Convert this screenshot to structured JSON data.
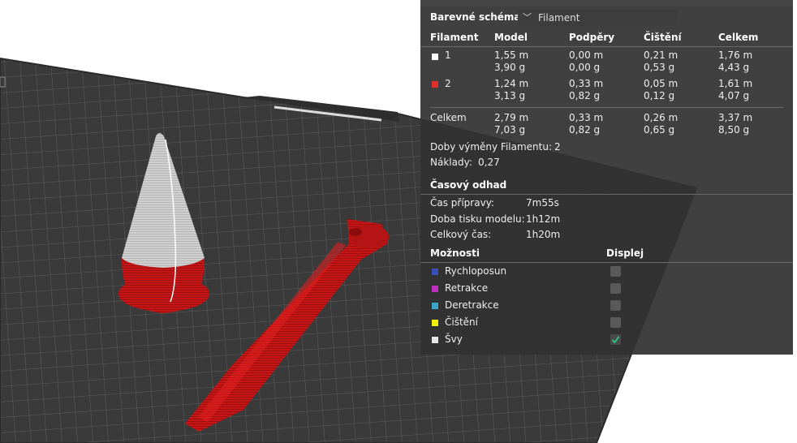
{
  "panel": {
    "color_scheme_label": "Barevné schéma",
    "color_scheme_value": "Filament",
    "columns": [
      "Filament",
      "Model",
      "Podpěry",
      "Čištění",
      "Celkem"
    ],
    "rows": [
      {
        "name": "1",
        "color": "#ffffff",
        "model": [
          "1,55 m",
          "3,90 g"
        ],
        "supports": [
          "0,00 m",
          "0,00 g"
        ],
        "purge": [
          "0,21 m",
          "0,53 g"
        ],
        "total": [
          "1,76 m",
          "4,43 g"
        ]
      },
      {
        "name": "2",
        "color": "#e0302a",
        "model": [
          "1,24 m",
          "3,13 g"
        ],
        "supports": [
          "0,33 m",
          "0,82 g"
        ],
        "purge": [
          "0,05 m",
          "0,12 g"
        ],
        "total": [
          "1,61 m",
          "4,07 g"
        ]
      }
    ],
    "totals": {
      "name": "Celkem",
      "model": [
        "2,79 m",
        "7,03 g"
      ],
      "supports": [
        "0,33 m",
        "0,82 g"
      ],
      "purge": [
        "0,26 m",
        "0,65 g"
      ],
      "total": [
        "3,37 m",
        "8,50 g"
      ]
    },
    "filament_changes_label": "Doby výměny Filamentu:",
    "filament_changes_value": "2",
    "cost_label": "Náklady:",
    "cost_value": "0,27",
    "time_section": "Časový odhad",
    "prep_label": "Čas přípravy:",
    "prep_value": "7m55s",
    "model_print_label": "Doba tisku modelu:",
    "model_print_value": "1h12m",
    "total_time_label": "Celkový čas:",
    "total_time_value": "1h20m",
    "options_label": "Možnosti",
    "display_label": "Displej",
    "options": [
      {
        "label": "Rychloposun",
        "color": "#3a4fb8",
        "checked": false
      },
      {
        "label": "Retrakce",
        "color": "#c02ec0",
        "checked": false
      },
      {
        "label": "Deretrakce",
        "color": "#3aa7c9",
        "checked": false
      },
      {
        "label": "Čištění",
        "color": "#f0f000",
        "checked": false
      },
      {
        "label": "Švy",
        "color": "#e6e6e6",
        "checked": true
      }
    ]
  }
}
